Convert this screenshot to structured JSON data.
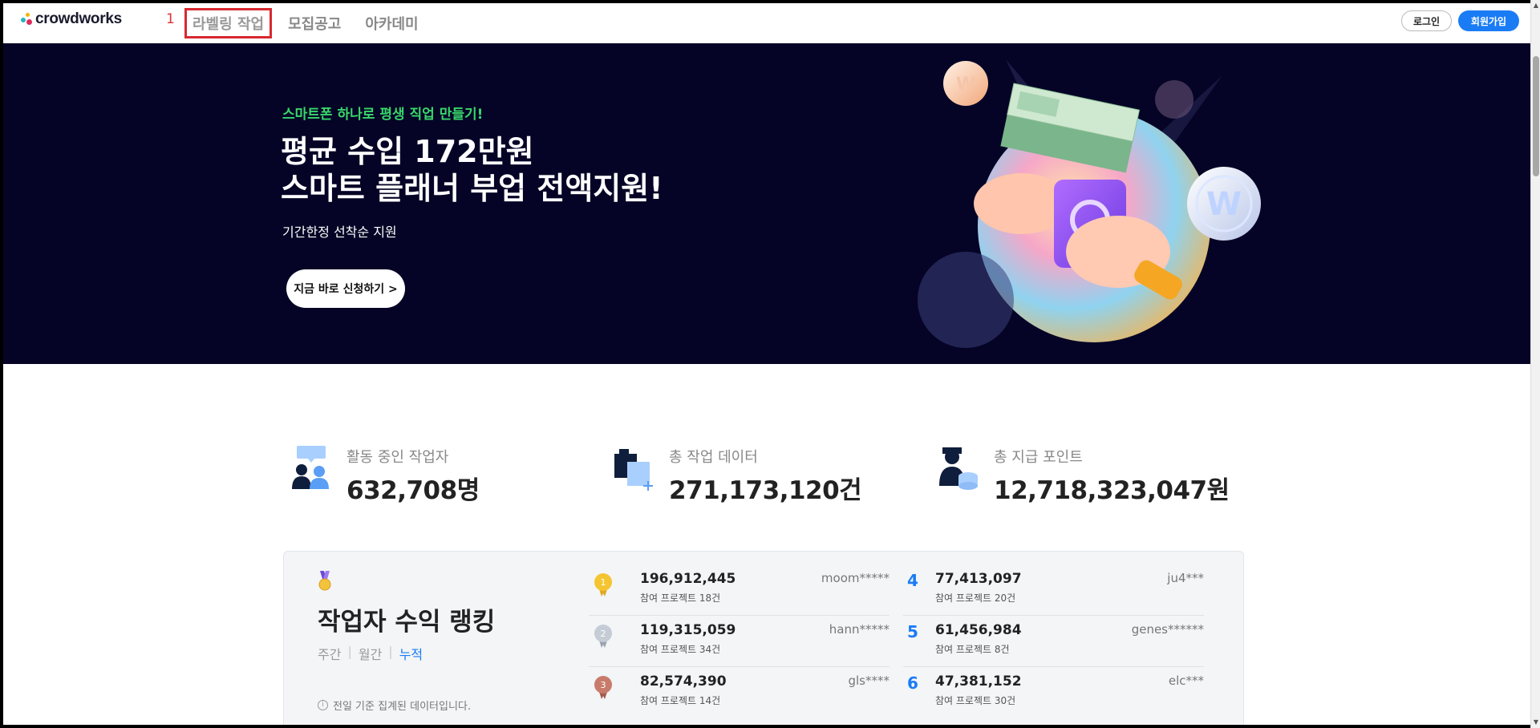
{
  "header": {
    "logo_text": "crowdworks",
    "nav_index": "1",
    "nav": [
      {
        "label": "라벨링 작업",
        "active": true
      },
      {
        "label": "모집공고",
        "active": false
      },
      {
        "label": "아카데미",
        "active": false
      }
    ],
    "login_label": "로그인",
    "signup_label": "회원가입"
  },
  "banner": {
    "subtitle": "스마트폰 하나로 평생 직업 만들기!",
    "title_line1": "평균 수입 172만원",
    "title_line2": "스마트 플래너 부업 전액지원!",
    "description": "기간한정 선착순 지원",
    "cta_label": "지금 바로 신청하기 >",
    "background_color": "#050426",
    "accent_color": "#38d66b"
  },
  "stats": [
    {
      "label": "활동 중인 작업자",
      "value": "632,708명",
      "icon": "workers-icon"
    },
    {
      "label": "총 작업 데이터",
      "value": "271,173,120건",
      "icon": "data-icon"
    },
    {
      "label": "총 지급 포인트",
      "value": "12,718,323,047원",
      "icon": "points-icon"
    }
  ],
  "ranking": {
    "title": "작업자 수익 랭킹",
    "tabs": [
      {
        "label": "주간",
        "active": false
      },
      {
        "label": "월간",
        "active": false
      },
      {
        "label": "누적",
        "active": true
      }
    ],
    "note": "전일 기준 집계된 데이터입니다.",
    "entries": [
      {
        "rank": "1",
        "amount": "196,912,445",
        "projects": "참여 프로젝트 18건",
        "user": "moom*****"
      },
      {
        "rank": "2",
        "amount": "119,315,059",
        "projects": "참여 프로젝트 34건",
        "user": "hann*****"
      },
      {
        "rank": "3",
        "amount": "82,574,390",
        "projects": "참여 프로젝트 14건",
        "user": "gls****"
      },
      {
        "rank": "4",
        "amount": "77,413,097",
        "projects": "참여 프로젝트 20건",
        "user": "ju4***"
      },
      {
        "rank": "5",
        "amount": "61,456,984",
        "projects": "참여 프로젝트 8건",
        "user": "genes******"
      },
      {
        "rank": "6",
        "amount": "47,381,152",
        "projects": "참여 프로젝트 30건",
        "user": "elc***"
      }
    ]
  },
  "colors": {
    "brand_blue": "#1a7cf5",
    "highlight_red": "#d8282f"
  }
}
